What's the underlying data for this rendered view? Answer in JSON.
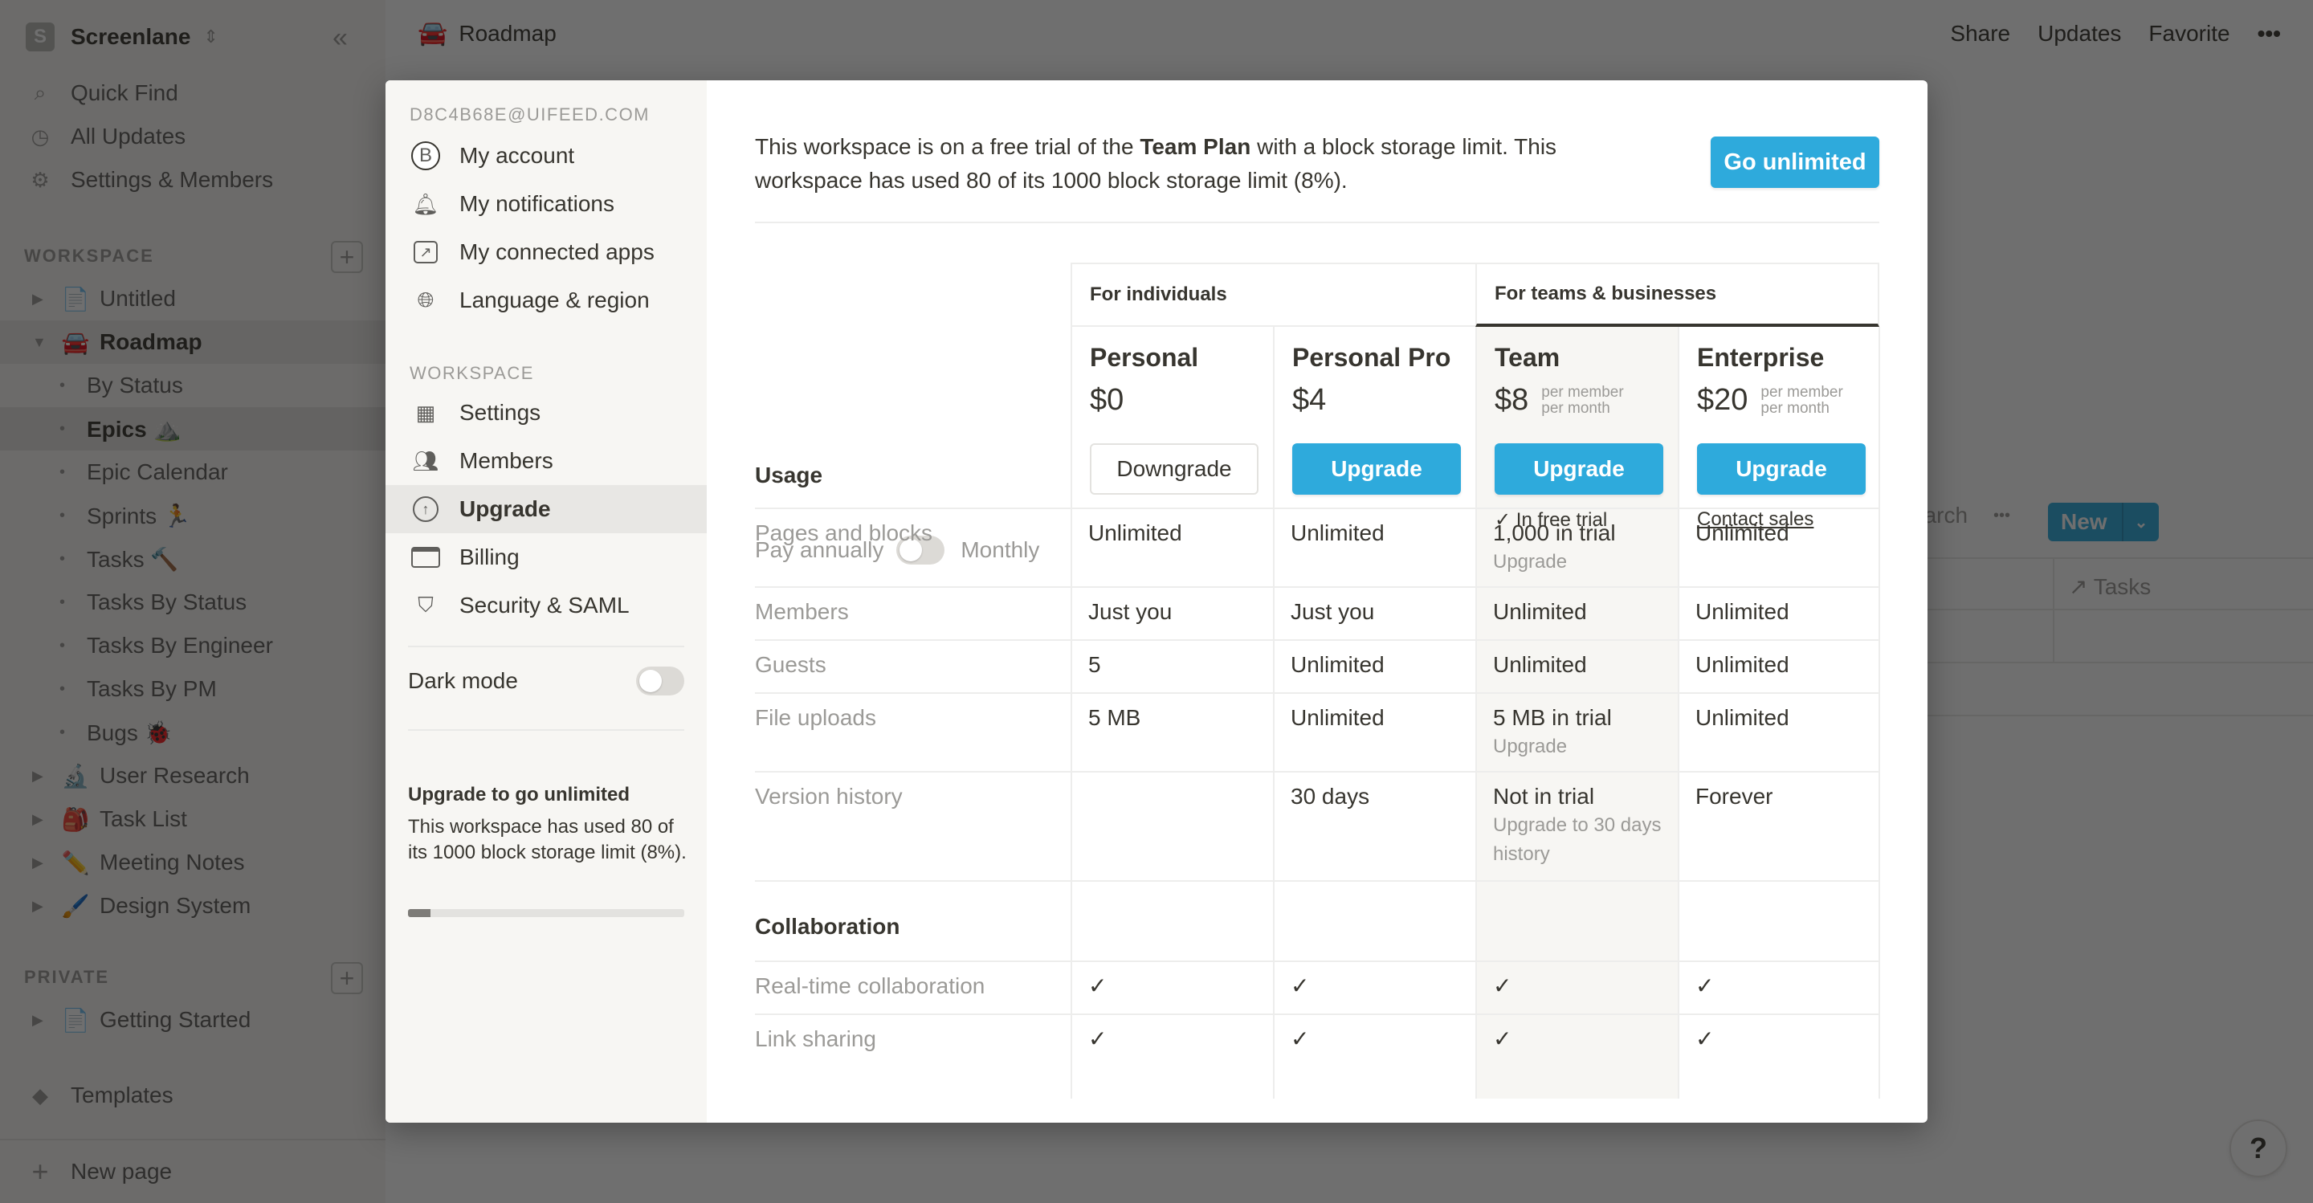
{
  "workspace": {
    "initial": "S",
    "name": "Screenlane"
  },
  "sidebar": {
    "nav": [
      {
        "label": "Quick Find",
        "icon": "search-icon"
      },
      {
        "label": "All Updates",
        "icon": "clock-icon"
      },
      {
        "label": "Settings & Members",
        "icon": "gear-icon"
      }
    ],
    "workspace_label": "WORKSPACE",
    "private_label": "PRIVATE",
    "tree": [
      {
        "label": "Untitled",
        "icon": "📄",
        "type": "page"
      },
      {
        "label": "Roadmap",
        "icon": "🚘",
        "type": "page",
        "expanded": true
      },
      {
        "label": "By Status",
        "type": "view"
      },
      {
        "label": "Epics ⛰️",
        "type": "view",
        "selected": true
      },
      {
        "label": "Epic Calendar",
        "type": "view"
      },
      {
        "label": "Sprints 🏃",
        "type": "view"
      },
      {
        "label": "Tasks 🔨",
        "type": "view"
      },
      {
        "label": "Tasks By Status",
        "type": "view"
      },
      {
        "label": "Tasks By Engineer",
        "type": "view"
      },
      {
        "label": "Tasks By PM",
        "type": "view"
      },
      {
        "label": "Bugs 🐞",
        "type": "view"
      },
      {
        "label": "User Research",
        "icon": "🔬",
        "type": "page"
      },
      {
        "label": "Task List",
        "icon": "🎒",
        "type": "page"
      },
      {
        "label": "Meeting Notes",
        "icon": "✏️",
        "type": "page"
      },
      {
        "label": "Design System",
        "icon": "🖌️",
        "type": "page"
      }
    ],
    "private_tree": [
      {
        "label": "Getting Started",
        "icon": "📄"
      }
    ],
    "templates_label": "Templates",
    "new_page_label": "New page"
  },
  "topbar": {
    "page_icon": "🚘",
    "page_title": "Roadmap",
    "actions": [
      "Share",
      "Updates",
      "Favorite"
    ],
    "more": "•••"
  },
  "background": {
    "search_partial": "earch",
    "more": "•••",
    "new_label": "New",
    "tasks_col": "Tasks"
  },
  "help_label": "?",
  "settings_modal": {
    "email": "D8C4B68E@UIFEED.COM",
    "account_items": [
      {
        "label": "My account",
        "icon": "B"
      },
      {
        "label": "My notifications",
        "icon": "bell-icon"
      },
      {
        "label": "My connected apps",
        "icon": "external-link-icon"
      },
      {
        "label": "Language & region",
        "icon": "globe-icon"
      }
    ],
    "workspace_label": "WORKSPACE",
    "workspace_items": [
      {
        "label": "Settings",
        "icon": "building-icon"
      },
      {
        "label": "Members",
        "icon": "people-icon"
      },
      {
        "label": "Upgrade",
        "icon": "arrow-up-circle-icon",
        "active": true
      },
      {
        "label": "Billing",
        "icon": "credit-card-icon"
      },
      {
        "label": "Security & SAML",
        "icon": "shield-icon"
      }
    ],
    "dark_mode_label": "Dark mode",
    "dark_mode_on": false,
    "upgrade_title": "Upgrade to go unlimited",
    "upgrade_desc": "This workspace has used 80 of its 1000 block storage limit (8%).",
    "usage_percent": 8
  },
  "upgrade": {
    "notice_pre": "This workspace is on a free trial of the ",
    "notice_bold": "Team Plan",
    "notice_post": " with a block storage limit. This workspace has used 80 of its 1000 block storage limit (8%).",
    "go_unlimited": "Go unlimited",
    "billing": {
      "annual": "Pay annually",
      "monthly": "Monthly",
      "monthly_selected": false
    },
    "groups": [
      "For individuals",
      "For teams & businesses"
    ],
    "plans": [
      {
        "name": "Personal",
        "price": "$0",
        "per": "",
        "button": "Downgrade",
        "note": ""
      },
      {
        "name": "Personal Pro",
        "price": "$4",
        "per": "",
        "button": "Upgrade",
        "note": ""
      },
      {
        "name": "Team",
        "price": "$8",
        "per": "per member\nper month",
        "button": "Upgrade",
        "note": "✓ In free trial"
      },
      {
        "name": "Enterprise",
        "price": "$20",
        "per": "per member\nper month",
        "button": "Upgrade",
        "note": "Contact sales"
      }
    ],
    "sections": [
      {
        "title": "Usage",
        "rows": [
          {
            "label": "Pages and blocks",
            "cells": [
              {
                "v": "Unlimited"
              },
              {
                "v": "Unlimited"
              },
              {
                "v": "1,000 in trial",
                "sub": "Upgrade"
              },
              {
                "v": "Unlimited"
              }
            ]
          },
          {
            "label": "Members",
            "cells": [
              {
                "v": "Just you"
              },
              {
                "v": "Just you"
              },
              {
                "v": "Unlimited"
              },
              {
                "v": "Unlimited"
              }
            ]
          },
          {
            "label": "Guests",
            "cells": [
              {
                "v": "5"
              },
              {
                "v": "Unlimited"
              },
              {
                "v": "Unlimited"
              },
              {
                "v": "Unlimited"
              }
            ]
          },
          {
            "label": "File uploads",
            "cells": [
              {
                "v": "5 MB"
              },
              {
                "v": "Unlimited"
              },
              {
                "v": "5 MB in trial",
                "sub": "Upgrade"
              },
              {
                "v": "Unlimited"
              }
            ]
          },
          {
            "label": "Version history",
            "cells": [
              {
                "v": ""
              },
              {
                "v": "30 days"
              },
              {
                "v": "Not in trial",
                "sub": "Upgrade to 30 days history"
              },
              {
                "v": "Forever"
              }
            ]
          }
        ]
      },
      {
        "title": "Collaboration",
        "rows": [
          {
            "label": "Real-time collaboration",
            "cells": [
              {
                "v": "✓"
              },
              {
                "v": "✓"
              },
              {
                "v": "✓"
              },
              {
                "v": "✓"
              }
            ]
          },
          {
            "label": "Link sharing",
            "cells": [
              {
                "v": "✓"
              },
              {
                "v": "✓"
              },
              {
                "v": "✓"
              },
              {
                "v": "✓"
              }
            ]
          }
        ]
      }
    ]
  }
}
